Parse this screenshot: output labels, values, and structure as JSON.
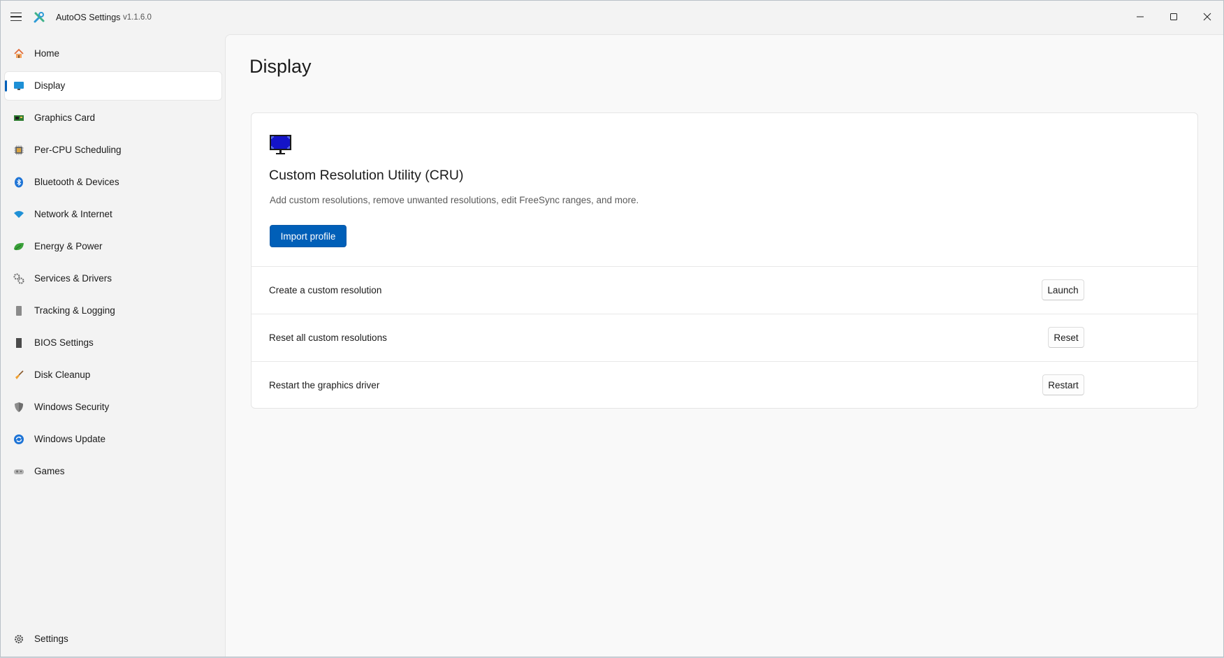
{
  "app": {
    "title": "AutoOS Settings",
    "version": "v1.1.6.0",
    "logo_icon": "wrench-screwdriver-icon"
  },
  "window_controls": {
    "minimize_icon": "minimize-icon",
    "maximize_icon": "maximize-icon",
    "close_icon": "close-icon"
  },
  "sidebar": {
    "items": [
      {
        "label": "Home",
        "icon": "home-icon",
        "selected": false
      },
      {
        "label": "Display",
        "icon": "monitor-icon",
        "selected": true
      },
      {
        "label": "Graphics Card",
        "icon": "graphics-card-icon",
        "selected": false
      },
      {
        "label": "Per-CPU Scheduling",
        "icon": "cpu-icon",
        "selected": false
      },
      {
        "label": "Bluetooth & Devices",
        "icon": "bluetooth-icon",
        "selected": false
      },
      {
        "label": "Network & Internet",
        "icon": "wifi-icon",
        "selected": false
      },
      {
        "label": "Energy & Power",
        "icon": "leaf-battery-icon",
        "selected": false
      },
      {
        "label": "Services & Drivers",
        "icon": "gears-icon",
        "selected": false
      },
      {
        "label": "Tracking & Logging",
        "icon": "document-icon",
        "selected": false
      },
      {
        "label": "BIOS Settings",
        "icon": "chip-icon",
        "selected": false
      },
      {
        "label": "Disk Cleanup",
        "icon": "broom-icon",
        "selected": false
      },
      {
        "label": "Windows Security",
        "icon": "shield-icon",
        "selected": false
      },
      {
        "label": "Windows Update",
        "icon": "update-icon",
        "selected": false
      },
      {
        "label": "Games",
        "icon": "gamepad-icon",
        "selected": false
      }
    ],
    "footer": {
      "label": "Settings",
      "icon": "gear-icon"
    }
  },
  "main": {
    "page_title": "Display",
    "cru_card": {
      "icon": "monitor-icon",
      "title": "Custom Resolution Utility (CRU)",
      "description": "Add custom resolutions, remove unwanted resolutions, edit FreeSync ranges, and more.",
      "primary_button": "Import profile",
      "rows": [
        {
          "label": "Create a custom resolution",
          "button": "Launch"
        },
        {
          "label": "Reset all custom resolutions",
          "button": "Reset"
        },
        {
          "label": "Restart the graphics driver",
          "button": "Restart"
        }
      ]
    }
  },
  "colors": {
    "accent": "#005fb8",
    "window_bg": "#f3f3f3",
    "content_bg": "#f9f9f9",
    "card_bg": "#ffffff"
  }
}
